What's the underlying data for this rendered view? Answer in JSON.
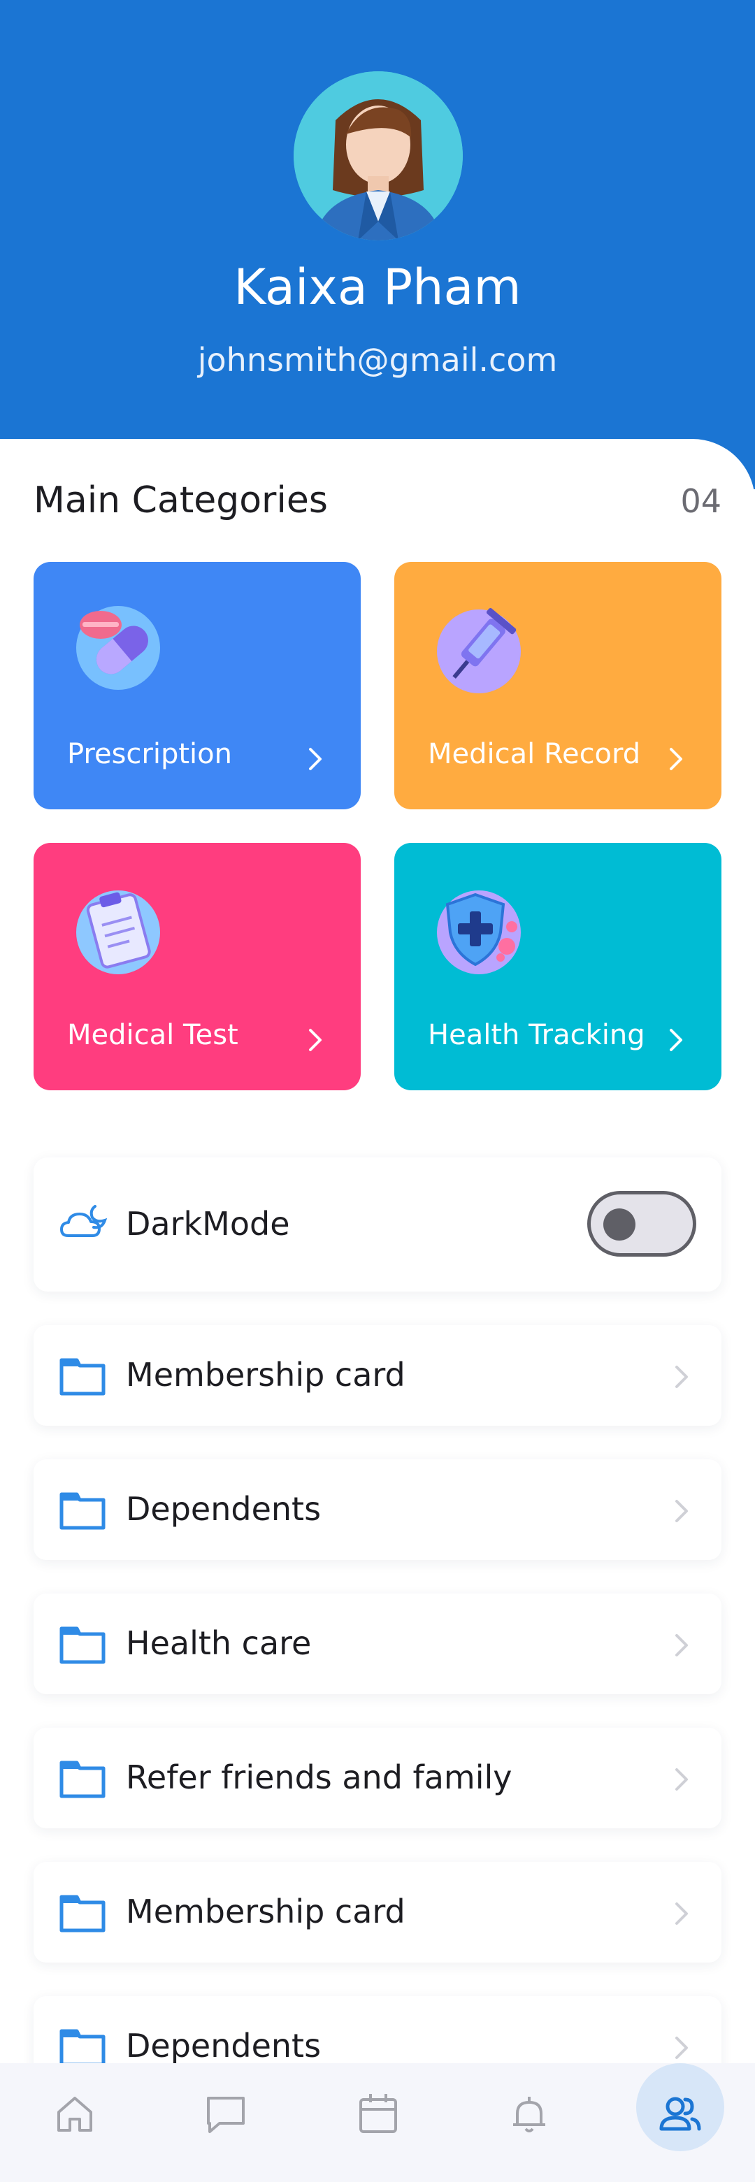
{
  "profile": {
    "name": "Kaixa Pham",
    "email": "johnsmith@gmail.com"
  },
  "categories": {
    "title": "Main Categories",
    "count": "04",
    "items": [
      {
        "label": "Prescription",
        "color": "#3f87f5",
        "icon": "pill-capsule-icon"
      },
      {
        "label": "Medical Record",
        "color": "#ffab40",
        "icon": "syringe-icon"
      },
      {
        "label": "Medical Test",
        "color": "#ff3d7f",
        "icon": "clipboard-icon"
      },
      {
        "label": "Health Tracking",
        "color": "#00bcd4",
        "icon": "shield-cross-icon"
      }
    ]
  },
  "settings": {
    "dark_mode": {
      "label": "DarkMode",
      "enabled": false,
      "icon": "cloud-moon-icon"
    },
    "items": [
      {
        "label": "Membership card",
        "icon": "folder-icon"
      },
      {
        "label": "Dependents",
        "icon": "folder-icon"
      },
      {
        "label": "Health care",
        "icon": "folder-icon"
      },
      {
        "label": "Refer friends and family",
        "icon": "folder-icon"
      },
      {
        "label": "Membership card",
        "icon": "folder-icon"
      },
      {
        "label": "Dependents",
        "icon": "folder-icon"
      }
    ]
  },
  "bottom_nav": {
    "items": [
      "home-icon",
      "chat-icon",
      "calendar-icon",
      "bell-icon",
      "users-icon"
    ],
    "active": "users-icon"
  },
  "colors": {
    "header": "#1b75d3",
    "accent": "#2f8be6"
  }
}
